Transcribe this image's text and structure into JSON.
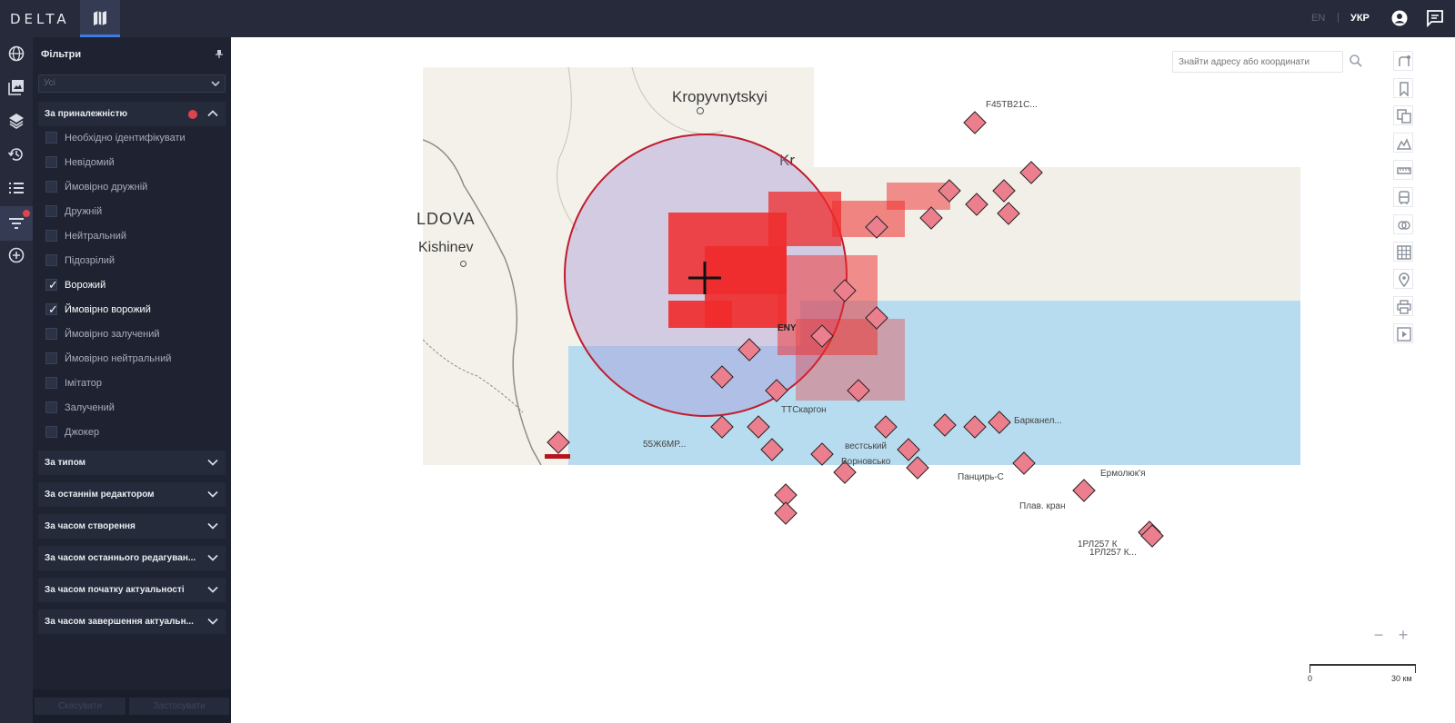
{
  "app": {
    "logo": "DELTA"
  },
  "header": {
    "lang_en": "EN",
    "lang_sep": "|",
    "lang_ukr": "УКР"
  },
  "panel": {
    "title": "Фільтри",
    "select_value": "Усі",
    "affiliation_section": "За приналежністю",
    "options": [
      {
        "label": "Необхідно ідентифікувати",
        "checked": false
      },
      {
        "label": "Невідомий",
        "checked": false
      },
      {
        "label": "Ймовірно дружній",
        "checked": false
      },
      {
        "label": "Дружній",
        "checked": false
      },
      {
        "label": "Нейтральний",
        "checked": false
      },
      {
        "label": "Підозрілий",
        "checked": false
      },
      {
        "label": "Ворожий",
        "checked": true
      },
      {
        "label": "Ймовірно ворожий",
        "checked": true
      },
      {
        "label": "Ймовірно залучений",
        "checked": false
      },
      {
        "label": "Ймовірно нейтральний",
        "checked": false
      },
      {
        "label": "Імітатор",
        "checked": false
      },
      {
        "label": "Залучений",
        "checked": false
      },
      {
        "label": "Джокер",
        "checked": false
      }
    ],
    "sections": [
      "За типом",
      "За останнім редактором",
      "За часом створення",
      "За часом останнього редагуван...",
      "За часом початку актуальності",
      "За часом завершення актуальн..."
    ],
    "footer": {
      "reset": "Скасувати",
      "apply": "Застосувати"
    }
  },
  "map": {
    "search_placeholder": "Знайти адресу або координати",
    "labels": {
      "kropyvnytskyi": "Kropyvnytskyi",
      "kr": "Kr",
      "moldova": "LDOVA",
      "kishinev": "Kishinev"
    },
    "units": [
      "F45TB21C...",
      "Барканел...",
      "Панцирь-С",
      "Плав. кран",
      "Ермолюк'я",
      "1РЛ257 К",
      "1РЛ257 К...",
      "55Ж6МР...",
      "ТТСкаргон",
      "вестський",
      "Ворновсько",
      "ENY"
    ],
    "scale": {
      "zero": "0",
      "end": "30 км"
    }
  }
}
